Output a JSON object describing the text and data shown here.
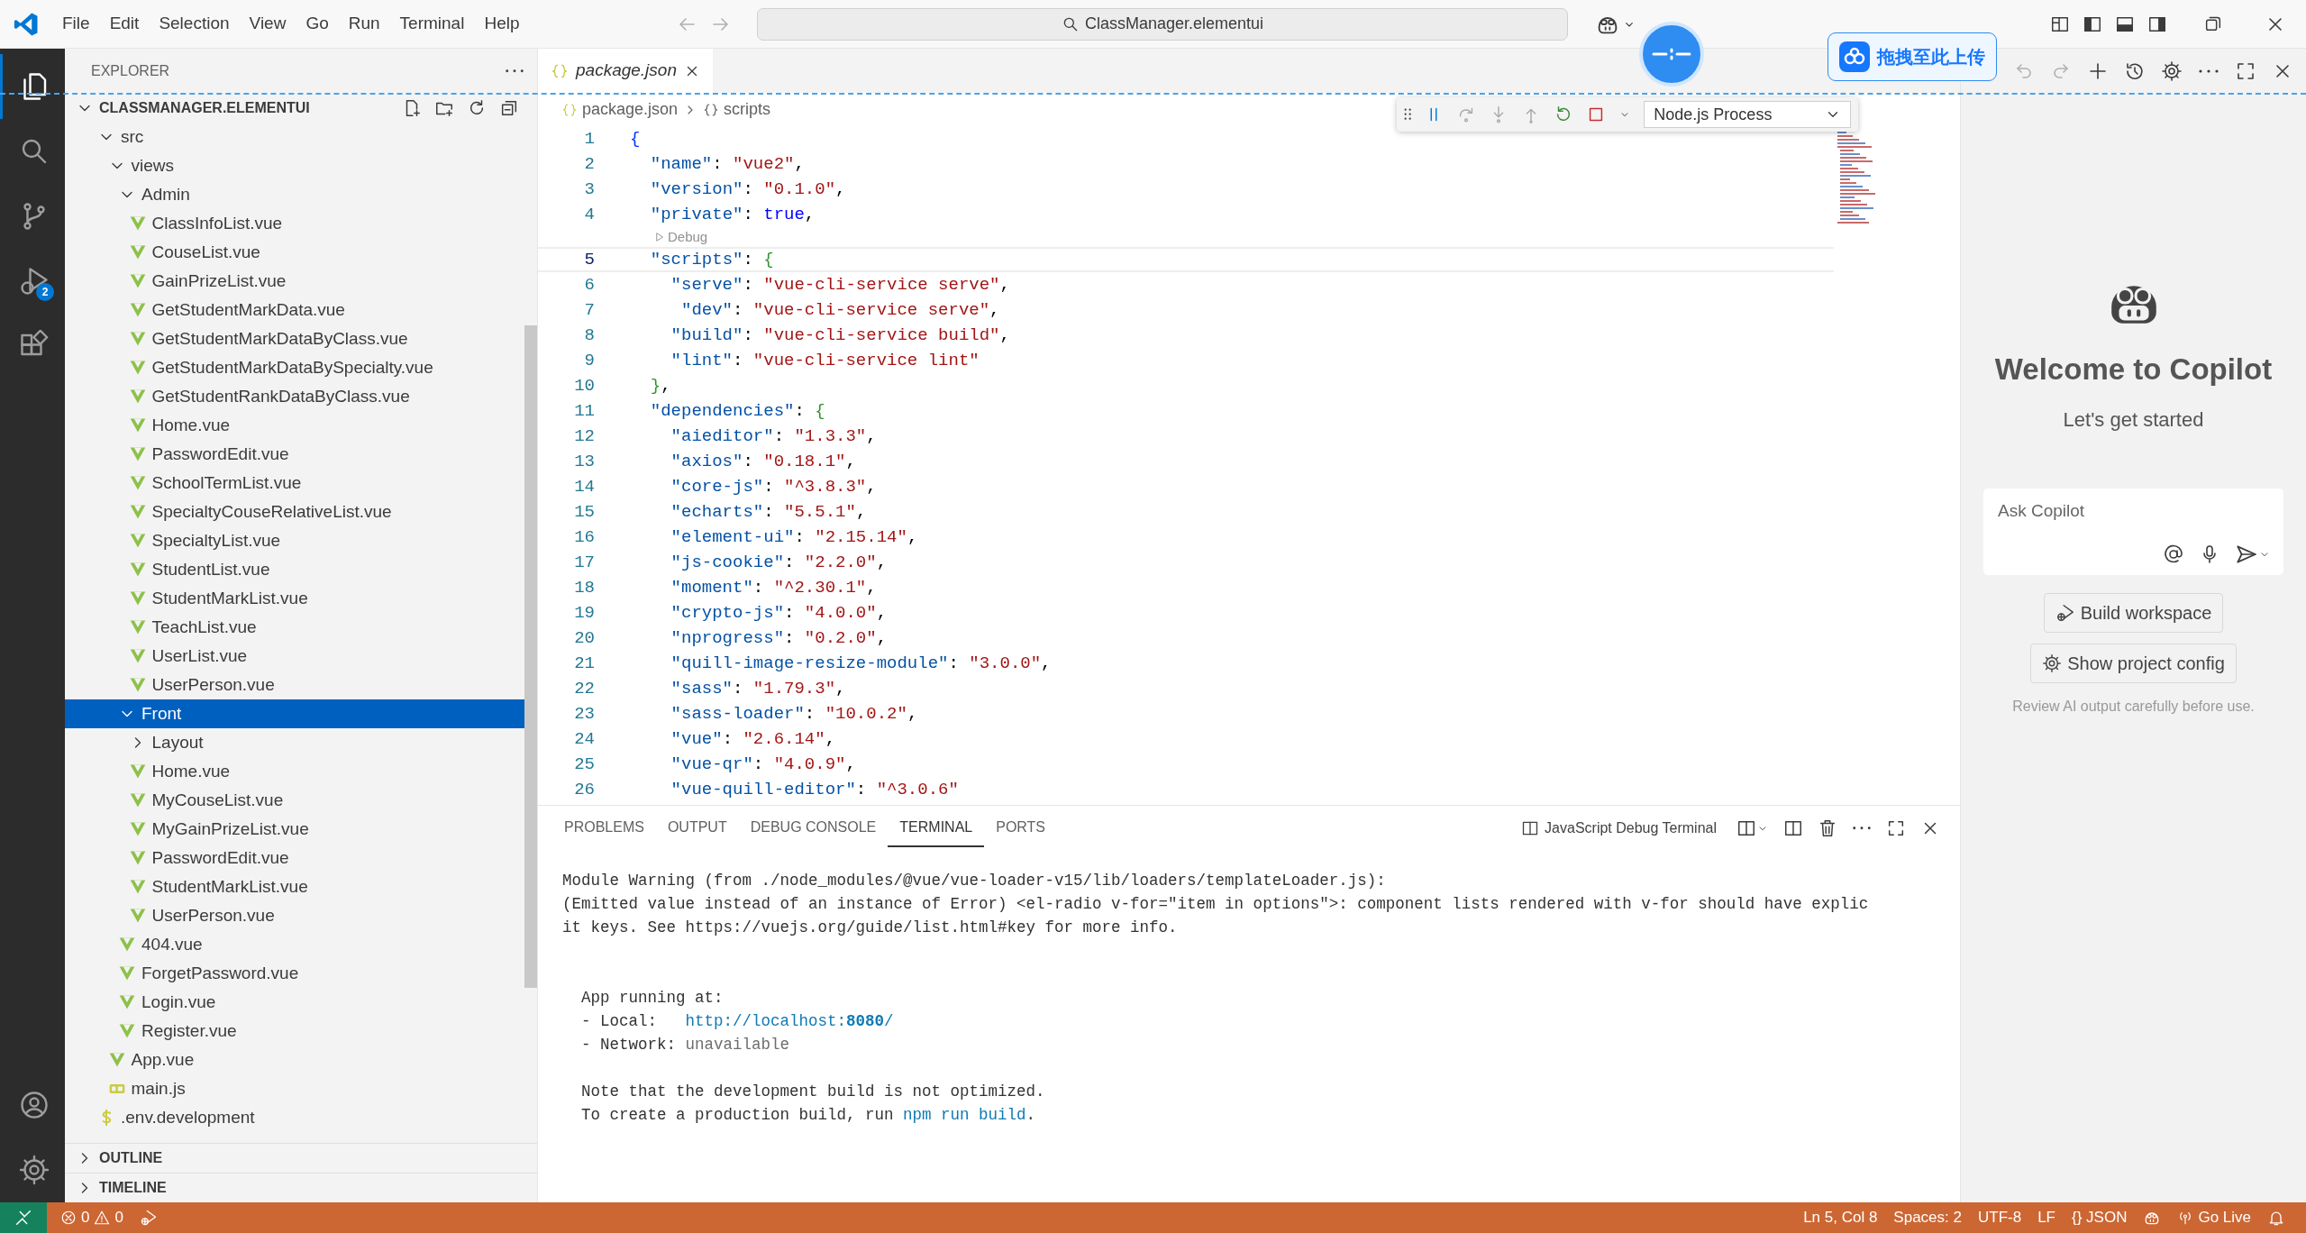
{
  "title_bar": {
    "menus": [
      "File",
      "Edit",
      "Selection",
      "View",
      "Go",
      "Run",
      "Terminal",
      "Help"
    ],
    "search": "ClassManager.elementui"
  },
  "overlay": {
    "upload_button": "拖拽至此上传"
  },
  "activity_bar": {
    "items": [
      {
        "selected": true
      },
      {
        "selected": false
      },
      {
        "selected": false
      },
      {
        "selected": false,
        "badge": "2"
      },
      {
        "selected": false
      }
    ]
  },
  "explorer": {
    "title": "EXPLORER",
    "root": {
      "label": "CLASSMANAGER.ELEMENTUI",
      "expanded": true
    },
    "tree": [
      {
        "label": "src",
        "kind": "folder",
        "expanded": true,
        "selected": false,
        "children": [
          {
            "label": "views",
            "kind": "folder",
            "expanded": true,
            "selected": false,
            "children": [
              {
                "label": "Admin",
                "kind": "folder",
                "expanded": true,
                "selected": false,
                "children": [
                  {
                    "label": "ClassInfoList.vue",
                    "kind": "vue",
                    "selected": false
                  },
                  {
                    "label": "CouseList.vue",
                    "kind": "vue",
                    "selected": false
                  },
                  {
                    "label": "GainPrizeList.vue",
                    "kind": "vue",
                    "selected": false
                  },
                  {
                    "label": "GetStudentMarkData.vue",
                    "kind": "vue",
                    "selected": false
                  },
                  {
                    "label": "GetStudentMarkDataByClass.vue",
                    "kind": "vue",
                    "selected": false
                  },
                  {
                    "label": "GetStudentMarkDataBySpecialty.vue",
                    "kind": "vue",
                    "selected": false
                  },
                  {
                    "label": "GetStudentRankDataByClass.vue",
                    "kind": "vue",
                    "selected": false
                  },
                  {
                    "label": "Home.vue",
                    "kind": "vue",
                    "selected": false
                  },
                  {
                    "label": "PasswordEdit.vue",
                    "kind": "vue",
                    "selected": false
                  },
                  {
                    "label": "SchoolTermList.vue",
                    "kind": "vue",
                    "selected": false
                  },
                  {
                    "label": "SpecialtyCouseRelativeList.vue",
                    "kind": "vue",
                    "selected": false
                  },
                  {
                    "label": "SpecialtyList.vue",
                    "kind": "vue",
                    "selected": false
                  },
                  {
                    "label": "StudentList.vue",
                    "kind": "vue",
                    "selected": false
                  },
                  {
                    "label": "StudentMarkList.vue",
                    "kind": "vue",
                    "selected": false
                  },
                  {
                    "label": "TeachList.vue",
                    "kind": "vue",
                    "selected": false
                  },
                  {
                    "label": "UserList.vue",
                    "kind": "vue",
                    "selected": false
                  },
                  {
                    "label": "UserPerson.vue",
                    "kind": "vue",
                    "selected": false
                  }
                ]
              },
              {
                "label": "Front",
                "kind": "folder",
                "expanded": true,
                "selected": true,
                "children": [
                  {
                    "label": "Layout",
                    "kind": "folder",
                    "expanded": false,
                    "selected": false
                  },
                  {
                    "label": "Home.vue",
                    "kind": "vue",
                    "selected": false
                  },
                  {
                    "label": "MyCouseList.vue",
                    "kind": "vue",
                    "selected": false
                  },
                  {
                    "label": "MyGainPrizeList.vue",
                    "kind": "vue",
                    "selected": false
                  },
                  {
                    "label": "PasswordEdit.vue",
                    "kind": "vue",
                    "selected": false
                  },
                  {
                    "label": "StudentMarkList.vue",
                    "kind": "vue",
                    "selected": false
                  },
                  {
                    "label": "UserPerson.vue",
                    "kind": "vue",
                    "selected": false
                  }
                ]
              },
              {
                "label": "404.vue",
                "kind": "vue",
                "selected": false
              },
              {
                "label": "ForgetPassword.vue",
                "kind": "vue",
                "selected": false
              },
              {
                "label": "Login.vue",
                "kind": "vue",
                "selected": false
              },
              {
                "label": "Register.vue",
                "kind": "vue",
                "selected": false
              }
            ]
          },
          {
            "label": "App.vue",
            "kind": "vue",
            "selected": false
          },
          {
            "label": "main.js",
            "kind": "js",
            "selected": false
          }
        ]
      },
      {
        "label": ".env.development",
        "kind": "env",
        "selected": false
      }
    ],
    "sections": [
      {
        "label": "OUTLINE",
        "expanded": false
      },
      {
        "label": "TIMELINE",
        "expanded": false
      }
    ]
  },
  "editor": {
    "tabs": [
      {
        "label": "package.json",
        "selected": true,
        "preview": true
      }
    ],
    "breadcrumb": [
      "package.json",
      "scripts"
    ],
    "debug_toolbar": {
      "target": "Node.js Process"
    },
    "lines": [
      {
        "kind": "code",
        "number": "1",
        "text": "{",
        "current": false
      },
      {
        "kind": "code",
        "number": "2",
        "text": "  \"name\": \"vue2\",",
        "current": false
      },
      {
        "kind": "code",
        "number": "3",
        "text": "  \"version\": \"0.1.0\",",
        "current": false
      },
      {
        "kind": "code",
        "number": "4",
        "text": "  \"private\": true,",
        "current": false
      },
      {
        "kind": "codelens",
        "text": "Debug"
      },
      {
        "kind": "code",
        "number": "5",
        "text": "  \"scripts\": {",
        "current": true
      },
      {
        "kind": "code",
        "number": "6",
        "text": "    \"serve\": \"vue-cli-service serve\",",
        "current": false
      },
      {
        "kind": "code",
        "number": "7",
        "text": "     \"dev\": \"vue-cli-service serve\",",
        "current": false
      },
      {
        "kind": "code",
        "number": "8",
        "text": "    \"build\": \"vue-cli-service build\",",
        "current": false
      },
      {
        "kind": "code",
        "number": "9",
        "text": "    \"lint\": \"vue-cli-service lint\"",
        "current": false
      },
      {
        "kind": "code",
        "number": "10",
        "text": "  },",
        "current": false
      },
      {
        "kind": "code",
        "number": "11",
        "text": "  \"dependencies\": {",
        "current": false
      },
      {
        "kind": "code",
        "number": "12",
        "text": "    \"aieditor\": \"1.3.3\",",
        "current": false
      },
      {
        "kind": "code",
        "number": "13",
        "text": "    \"axios\": \"0.18.1\",",
        "current": false
      },
      {
        "kind": "code",
        "number": "14",
        "text": "    \"core-js\": \"^3.8.3\",",
        "current": false
      },
      {
        "kind": "code",
        "number": "15",
        "text": "    \"echarts\": \"5.5.1\",",
        "current": false
      },
      {
        "kind": "code",
        "number": "16",
        "text": "    \"element-ui\": \"2.15.14\",",
        "current": false
      },
      {
        "kind": "code",
        "number": "17",
        "text": "    \"js-cookie\": \"2.2.0\",",
        "current": false
      },
      {
        "kind": "code",
        "number": "18",
        "text": "    \"moment\": \"^2.30.1\",",
        "current": false
      },
      {
        "kind": "code",
        "number": "19",
        "text": "    \"crypto-js\": \"4.0.0\",",
        "current": false
      },
      {
        "kind": "code",
        "number": "20",
        "text": "    \"nprogress\": \"0.2.0\",",
        "current": false
      },
      {
        "kind": "code",
        "number": "21",
        "text": "    \"quill-image-resize-module\": \"3.0.0\",",
        "current": false
      },
      {
        "kind": "code",
        "number": "22",
        "text": "    \"sass\": \"1.79.3\",",
        "current": false
      },
      {
        "kind": "code",
        "number": "23",
        "text": "    \"sass-loader\": \"10.0.2\",",
        "current": false
      },
      {
        "kind": "code",
        "number": "24",
        "text": "    \"vue\": \"2.6.14\",",
        "current": false
      },
      {
        "kind": "code",
        "number": "25",
        "text": "    \"vue-qr\": \"4.0.9\",",
        "current": false
      },
      {
        "kind": "code",
        "number": "26",
        "text": "    \"vue-quill-editor\": \"^3.0.6\"",
        "current": false
      }
    ]
  },
  "panel": {
    "tabs": [
      {
        "label": "PROBLEMS",
        "selected": false
      },
      {
        "label": "OUTPUT",
        "selected": false
      },
      {
        "label": "DEBUG CONSOLE",
        "selected": false
      },
      {
        "label": "TERMINAL",
        "selected": true
      },
      {
        "label": "PORTS",
        "selected": false
      }
    ],
    "terminal_name": "JavaScript Debug Terminal",
    "lines": [
      {
        "kind": "text",
        "segments": [
          {
            "text": "Module Warning (from ./node_modules/@vue/vue-loader-v15/lib/loaders/templateLoader.js):",
            "kind": "plain"
          }
        ]
      },
      {
        "kind": "text",
        "segments": [
          {
            "text": "(Emitted value instead of an instance of Error) <el-radio v-for=\"item in options\">: component lists rendered with v-for should have explic",
            "kind": "plain"
          }
        ]
      },
      {
        "kind": "text",
        "segments": [
          {
            "text": "it keys. See https://vuejs.org/guide/list.html#key for more info.",
            "kind": "plain"
          }
        ]
      },
      {
        "kind": "blank"
      },
      {
        "kind": "blank"
      },
      {
        "kind": "text",
        "segments": [
          {
            "text": "  App running at:",
            "kind": "plain"
          }
        ]
      },
      {
        "kind": "text",
        "segments": [
          {
            "text": "  - Local:   ",
            "kind": "plain"
          },
          {
            "text": "http://localhost:**8080**/",
            "kind": "link"
          }
        ]
      },
      {
        "kind": "text",
        "segments": [
          {
            "text": "  - Network: ",
            "kind": "plain"
          },
          {
            "text": "unavailable",
            "kind": "dim"
          }
        ]
      },
      {
        "kind": "blank"
      },
      {
        "kind": "text",
        "segments": [
          {
            "text": "  Note that the development build is not optimized.",
            "kind": "plain"
          }
        ]
      },
      {
        "kind": "text",
        "segments": [
          {
            "text": "  To create a production build, run ",
            "kind": "plain"
          },
          {
            "text": "npm run build",
            "kind": "command"
          },
          {
            "text": ".",
            "kind": "plain"
          }
        ]
      }
    ]
  },
  "copilot": {
    "title": "Welcome to Copilot",
    "subtitle": "Let's get started",
    "input": {
      "placeholder": "Ask Copilot"
    },
    "buttons": [
      "Build workspace",
      "Show project config"
    ],
    "note": "Review AI output carefully before use."
  },
  "status_bar": {
    "errors": "0",
    "warnings": "0",
    "right": [
      "Ln 5, Col 8",
      "Spaces: 2",
      "UTF-8",
      "LF",
      "{} JSON",
      "Go Live"
    ]
  }
}
